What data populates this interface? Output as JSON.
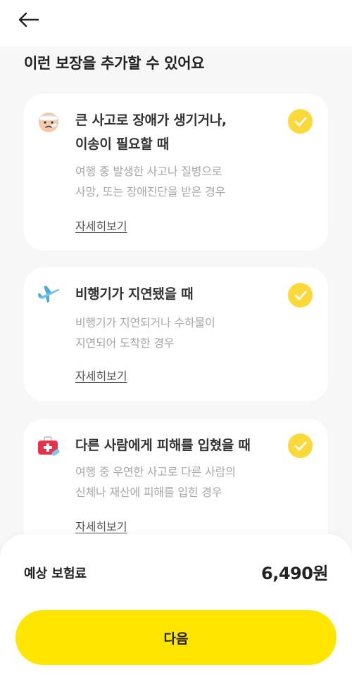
{
  "header": {
    "back_icon": "arrow-left-icon"
  },
  "section": {
    "title": "이런 보장을 추가할 수 있어요"
  },
  "cards": [
    {
      "icon": "injured-person-icon",
      "title_line1": "큰 사고로 장애가 생기거나,",
      "title_line2": "이송이 필요할 때",
      "desc_line1": "여행 중 발생한 사고나 질병으로",
      "desc_line2": "사망, 또는 장애진단을 받은 경우",
      "link": "자세히보기",
      "checked": true
    },
    {
      "icon": "airplane-icon",
      "title_line1": "비행기가 지연됐을 때",
      "desc_line1": "비행기가 지연되거나 수하물이",
      "desc_line2": "지연되어 도착한 경우",
      "link": "자세히보기",
      "checked": true
    },
    {
      "icon": "first-aid-kit-icon",
      "title_line1": "다른 사람에게 피해를 입혔을 때",
      "desc_line1": "여행 중 우연한 사고로 다른 사람의",
      "desc_line2": "신체나 재산에 피해를 입힌 경우",
      "link": "자세히보기",
      "checked": true
    }
  ],
  "footer": {
    "price_label": "예상 보험료",
    "price_value": "6,490원",
    "next_label": "다음"
  },
  "colors": {
    "accent": "#ffe600",
    "check": "#fbd93b",
    "background": "#f7f7f7"
  }
}
